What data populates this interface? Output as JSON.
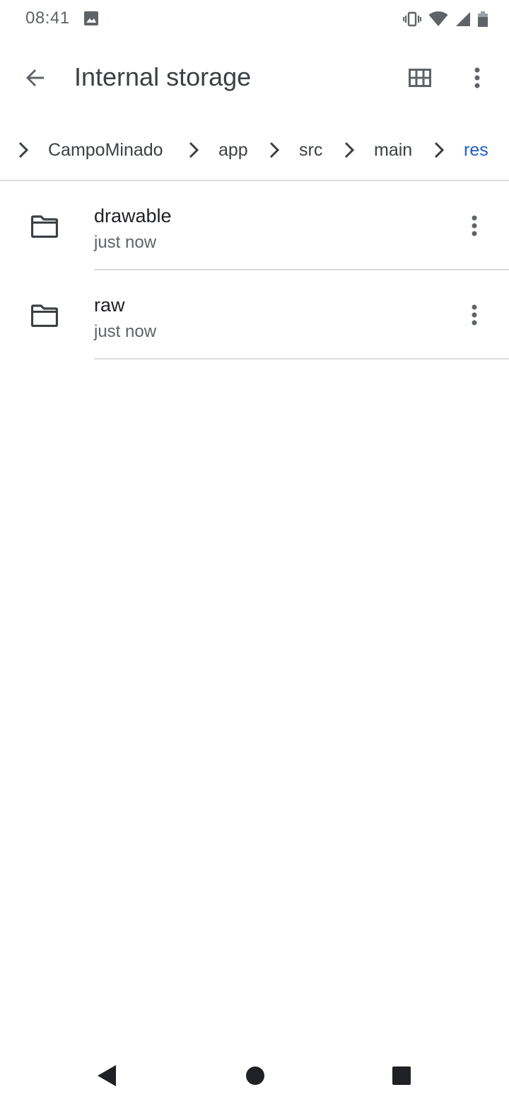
{
  "status_bar": {
    "time": "08:41",
    "icons": [
      "image-notification-icon",
      "vibrate-icon",
      "wifi-icon",
      "signal-icon",
      "battery-icon"
    ]
  },
  "app_bar": {
    "title": "Internal storage",
    "back_icon": "arrow-back-icon",
    "grid_icon": "grid-view-icon",
    "more_icon": "more-vert-icon"
  },
  "breadcrumb": {
    "items": [
      {
        "label": "CampoMinado"
      },
      {
        "label": "app"
      },
      {
        "label": "src"
      },
      {
        "label": "main"
      },
      {
        "label": "res",
        "active": true
      }
    ],
    "active_color": "#1a5fc4"
  },
  "files": [
    {
      "name": "drawable",
      "meta": "just now",
      "icon": "folder-icon"
    },
    {
      "name": "raw",
      "meta": "just now",
      "icon": "folder-icon"
    }
  ],
  "nav_bar": {
    "icons": [
      "nav-back-icon",
      "nav-home-icon",
      "nav-recents-icon"
    ]
  }
}
